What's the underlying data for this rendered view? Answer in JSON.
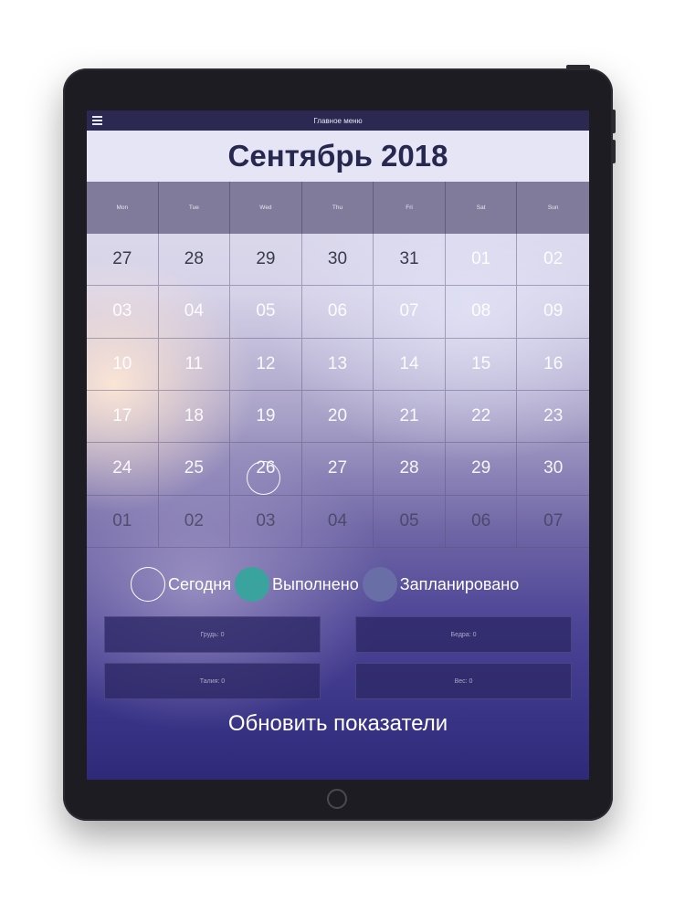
{
  "topbar": {
    "title": "Главное меню",
    "menu_icon": "hamburger-menu-icon"
  },
  "calendar": {
    "month_title": "Сентябрь 2018",
    "weekdays": [
      "Mon",
      "Tue",
      "Wed",
      "Thu",
      "Fri",
      "Sat",
      "Sun"
    ],
    "weeks": [
      [
        "27",
        "28",
        "29",
        "30",
        "31",
        "01",
        "02"
      ],
      [
        "03",
        "04",
        "05",
        "06",
        "07",
        "08",
        "09"
      ],
      [
        "10",
        "11",
        "12",
        "13",
        "14",
        "15",
        "16"
      ],
      [
        "17",
        "18",
        "19",
        "20",
        "21",
        "22",
        "23"
      ],
      [
        "24",
        "25",
        "26",
        "27",
        "28",
        "29",
        "30"
      ],
      [
        "01",
        "02",
        "03",
        "04",
        "05",
        "06",
        "07"
      ]
    ],
    "today": "26"
  },
  "legend": {
    "today_label": "Сегодня",
    "done_label": "Выполнено",
    "planned_label": "Запланировано",
    "done_color": "#3aa39e",
    "planned_color": "#6a6ea6"
  },
  "measurements": {
    "chest": "Грудь: 0",
    "hips": "Бедра: 0",
    "waist": "Талия: 0",
    "weight": "Вес: 0"
  },
  "actions": {
    "update_label": "Обновить показатели"
  }
}
